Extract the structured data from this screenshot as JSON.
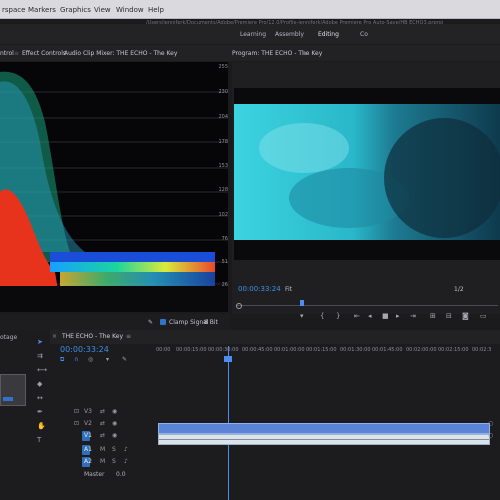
{
  "menu": {
    "items": [
      "rspace",
      "Markers",
      "Graphics",
      "View",
      "Window",
      "Help"
    ],
    "path": "/Users/jenniferk/Documents/Adobe/Premiere Pro/12.0/Profile-jenniferk/Adobe Premiere Pro Auto-Save/HB ECHO3.prproj"
  },
  "workspace_tabs": [
    "Learning",
    "Assembly",
    "Editing",
    "Co"
  ],
  "left_tabs": {
    "tab1": "ntrol",
    "tab2": "Effect Controls",
    "tab3": "Audio Clip Mixer: THE ECHO - The Key"
  },
  "program": {
    "title": "Program: THE ECHO - The Key",
    "timecode": "00:00:33:24",
    "zoom": "Fit",
    "resolution": "1/2"
  },
  "scope": {
    "scale": [
      "255",
      "230",
      "204",
      "178",
      "153",
      "128",
      "102",
      "76",
      "51",
      "26"
    ],
    "clamp_label": "Clamp Signal",
    "bit_depth": "8 Bit"
  },
  "timeline": {
    "sequence_name": "THE ECHO - The Key",
    "timecode": "00:00:33:24",
    "ruler": [
      "00:00",
      "00:00:15:00",
      "00:00:30:00",
      "00:00:45:00",
      "00:01:00:00",
      "00:01:15:00",
      "00:01:30:00",
      "00:01:45:00",
      "00:02:00:00",
      "00:02:15:00",
      "00:02:3"
    ],
    "tracks": [
      "V3",
      "V2",
      "V1",
      "A1",
      "A2",
      "A3"
    ],
    "master_label": "Master",
    "master_value": "0.0"
  },
  "project": {
    "label": "otage"
  },
  "colors": {
    "timecode_blue": "#3d8ee6",
    "clip_video": "#5b84d6",
    "clip_audio": "#dde3ea",
    "playhead": "#4b8ef2"
  }
}
